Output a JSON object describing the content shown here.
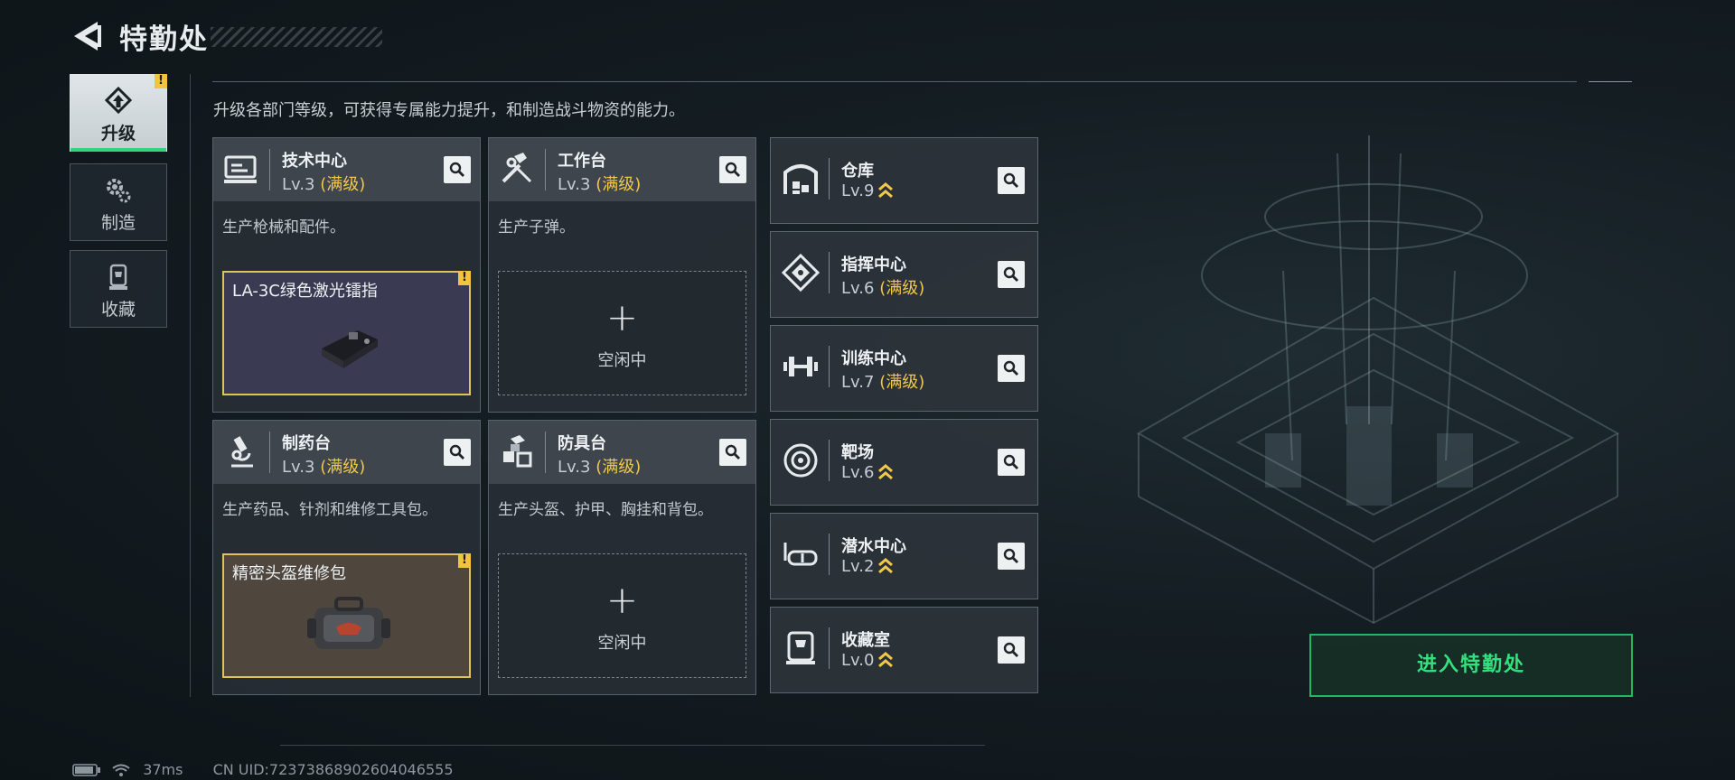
{
  "header": {
    "title": "特勤处"
  },
  "tabs": [
    {
      "label": "升级",
      "icon": "upgrade-icon",
      "active": true,
      "alert": "!"
    },
    {
      "label": "制造",
      "icon": "gears-icon",
      "active": false
    },
    {
      "label": "收藏",
      "icon": "trophy-icon",
      "active": false
    }
  ],
  "subtitle": "升级各部门等级，可获得专属能力提升，和制造战斗物资的能力。",
  "departments": [
    {
      "name": "技术中心",
      "level": "Lv.3",
      "status": "(满级)",
      "desc": "生产枪械和配件。",
      "slot": {
        "type": "filled",
        "item": "LA-3C绿色激光镭指",
        "alert": "!"
      }
    },
    {
      "name": "工作台",
      "level": "Lv.3",
      "status": "(满级)",
      "desc": "生产子弹。",
      "slot": {
        "type": "empty",
        "plus": "+",
        "idle": "空闲中"
      }
    },
    {
      "name": "制药台",
      "level": "Lv.3",
      "status": "(满级)",
      "desc": "生产药品、针剂和维修工具包。",
      "slot": {
        "type": "filled",
        "item": "精密头盔维修包",
        "alert": "!"
      }
    },
    {
      "name": "防具台",
      "level": "Lv.3",
      "status": "(满级)",
      "desc": "生产头盔、护甲、胸挂和背包。",
      "slot": {
        "type": "empty",
        "plus": "+",
        "idle": "空闲中"
      }
    }
  ],
  "facilities": [
    {
      "name": "仓库",
      "level": "Lv.9",
      "status": "",
      "upgradable": true
    },
    {
      "name": "指挥中心",
      "level": "Lv.6",
      "status": "(满级)",
      "upgradable": false
    },
    {
      "name": "训练中心",
      "level": "Lv.7",
      "status": "(满级)",
      "upgradable": false
    },
    {
      "name": "靶场",
      "level": "Lv.6",
      "status": "",
      "upgradable": true
    },
    {
      "name": "潜水中心",
      "level": "Lv.2",
      "status": "",
      "upgradable": true
    },
    {
      "name": "收藏室",
      "level": "Lv.0",
      "status": "",
      "upgradable": true
    }
  ],
  "enter_button": "进入特勤处",
  "status_bar": {
    "ping": "37ms",
    "uid": "CN UID:72373868902604046555"
  },
  "colors": {
    "accent_green": "#2fd77a",
    "max_level_gold": "#f1c84b",
    "alert_yellow": "#f2c33c"
  }
}
